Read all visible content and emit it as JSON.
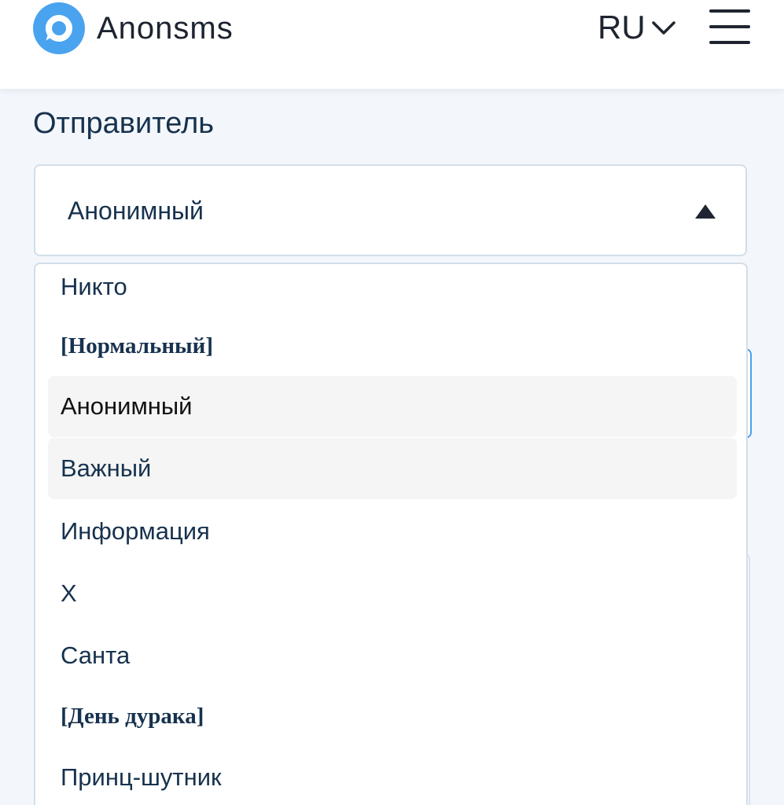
{
  "header": {
    "brand_name": "Anonsms",
    "language": "RU",
    "logo_icon": "chat-bubble-icon",
    "colors": {
      "brand": "#4aa3ef",
      "text_dark": "#1f2530"
    }
  },
  "sender": {
    "label": "Отправитель",
    "selected_value": "Анонимный",
    "arrow_icon": "triangle-up-icon"
  },
  "dropdown": {
    "items": [
      {
        "label": "Никто",
        "type": "option"
      },
      {
        "label": "[Нормальный]",
        "type": "group"
      },
      {
        "label": "Анонимный",
        "type": "option",
        "selected": true
      },
      {
        "label": "Важный",
        "type": "option",
        "hovered": true
      },
      {
        "label": "Информация",
        "type": "option"
      },
      {
        "label": "X",
        "type": "option"
      },
      {
        "label": "Санта",
        "type": "option"
      },
      {
        "label": "[День дурака]",
        "type": "group"
      },
      {
        "label": "Принц-шутник",
        "type": "option"
      }
    ]
  },
  "colors": {
    "page_background": "#f3f7fc",
    "label_text": "#17324e",
    "option_highlight": "#f5f5f5",
    "focus_border": "#4aa0e8"
  }
}
